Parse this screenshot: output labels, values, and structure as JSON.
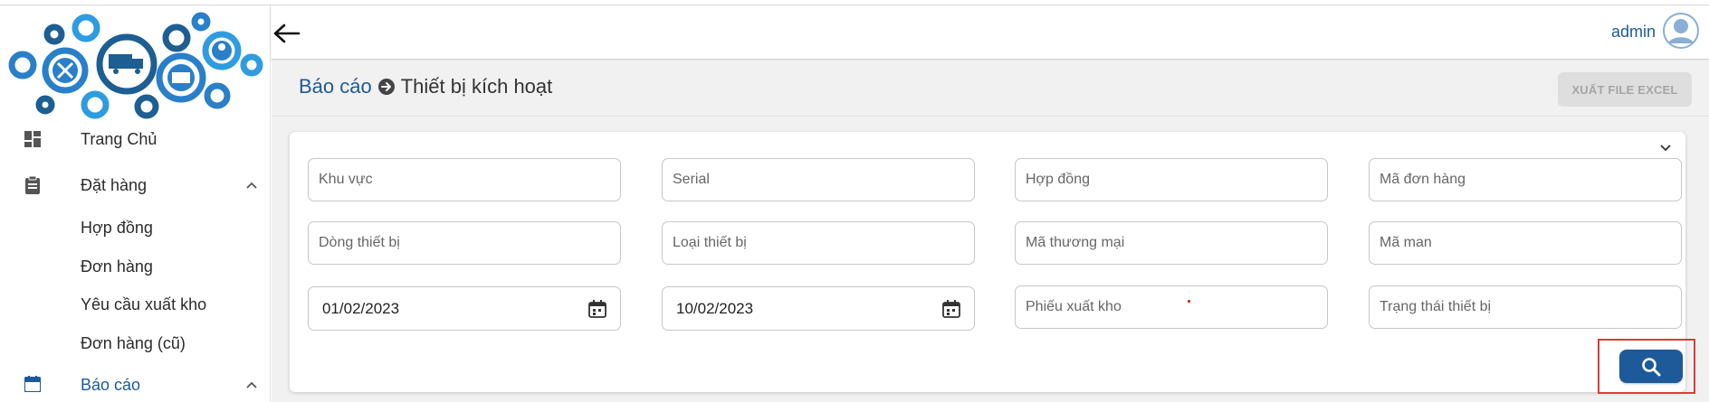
{
  "header": {
    "user_name": "admin"
  },
  "sidebar": {
    "items": [
      {
        "label": "Trang Chủ",
        "icon": "dashboard-icon"
      },
      {
        "label": "Đặt hàng",
        "icon": "clipboard-icon",
        "expanded": true,
        "children": [
          "Hợp đồng",
          "Đơn hàng",
          "Yêu cầu xuất kho",
          "Đơn hàng (cũ)"
        ]
      },
      {
        "label": "Báo cáo",
        "icon": "calendar-icon",
        "expanded": true,
        "active": true
      }
    ]
  },
  "breadcrumb": {
    "parent": "Báo cáo",
    "current": "Thiết bị kích hoạt"
  },
  "toolbar": {
    "export_label": "XUẤT FILE EXCEL"
  },
  "filters": {
    "khu_vuc": {
      "placeholder": "Khu vực"
    },
    "serial": {
      "placeholder": "Serial"
    },
    "hop_dong": {
      "placeholder": "Hợp đồng"
    },
    "ma_don_hang": {
      "placeholder": "Mã đơn hàng"
    },
    "dong_thiet_bi": {
      "placeholder": "Dòng thiết bị"
    },
    "loai_thiet_bi": {
      "placeholder": "Loại thiết bị"
    },
    "ma_thuong_mai": {
      "placeholder": "Mã thương mại"
    },
    "ma_man": {
      "placeholder": "Mã man"
    },
    "tu_ngay": {
      "value": "01/02/2023"
    },
    "den_ngay": {
      "value": "10/02/2023"
    },
    "phieu_xuat_kho": {
      "placeholder": "Phiếu xuất kho"
    },
    "trang_thai": {
      "placeholder": "Trạng thái thiết bị"
    }
  },
  "colors": {
    "primary": "#1e5a99",
    "highlight": "#e03a3a",
    "export_disabled_bg": "#dedede"
  }
}
